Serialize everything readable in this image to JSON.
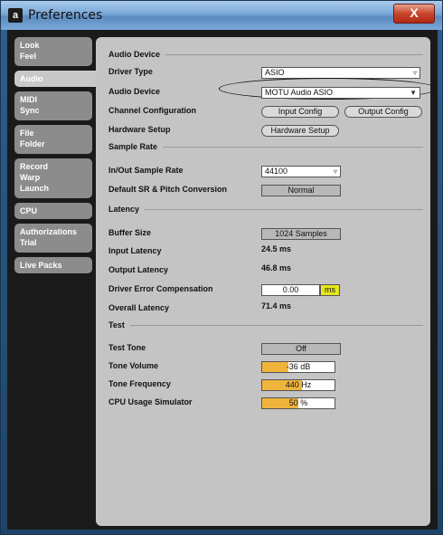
{
  "window": {
    "title": "Preferences",
    "close_label": "X"
  },
  "sidebar": {
    "tabs": [
      {
        "label": "Look\nFeel"
      },
      {
        "label": "Audio"
      },
      {
        "label": "MIDI\nSync"
      },
      {
        "label": "File\nFolder"
      },
      {
        "label": "Record\nWarp\nLaunch"
      },
      {
        "label": "CPU"
      },
      {
        "label": "Authorizations\nTrial"
      },
      {
        "label": "Live Packs"
      }
    ]
  },
  "audio_device": {
    "section": "Audio Device",
    "driver_type_label": "Driver Type",
    "driver_type_value": "ASIO",
    "audio_device_label": "Audio Device",
    "audio_device_value": "MOTU Audio ASIO",
    "channel_config_label": "Channel Configuration",
    "input_config": "Input Config",
    "output_config": "Output Config",
    "hardware_setup_label": "Hardware Setup",
    "hardware_setup_button": "Hardware Setup"
  },
  "sample_rate": {
    "section": "Sample Rate",
    "inout_label": "In/Out Sample Rate",
    "inout_value": "44100",
    "default_sr_label": "Default SR & Pitch Conversion",
    "default_sr_value": "Normal"
  },
  "latency": {
    "section": "Latency",
    "buffer_label": "Buffer Size",
    "buffer_value": "1024 Samples",
    "input_label": "Input Latency",
    "input_value": "24.5 ms",
    "output_label": "Output Latency",
    "output_value": "46.8 ms",
    "driver_comp_label": "Driver Error Compensation",
    "driver_comp_value": "0.00",
    "driver_comp_unit": "ms",
    "overall_label": "Overall Latency",
    "overall_value": "71.4 ms"
  },
  "test": {
    "section": "Test",
    "tone_label": "Test Tone",
    "tone_value": "Off",
    "volume_label": "Tone Volume",
    "volume_value": "-36",
    "volume_unit": "dB",
    "volume_fill_pct": 36,
    "freq_label": "Tone Frequency",
    "freq_value": "440",
    "freq_unit": "Hz",
    "freq_fill_pct": 55,
    "cpu_label": "CPU Usage Simulator",
    "cpu_value": "50 %",
    "cpu_fill_pct": 50
  },
  "colors": {
    "accent_orange": "#f0b43c",
    "ms_yellow": "#e6e61e"
  }
}
